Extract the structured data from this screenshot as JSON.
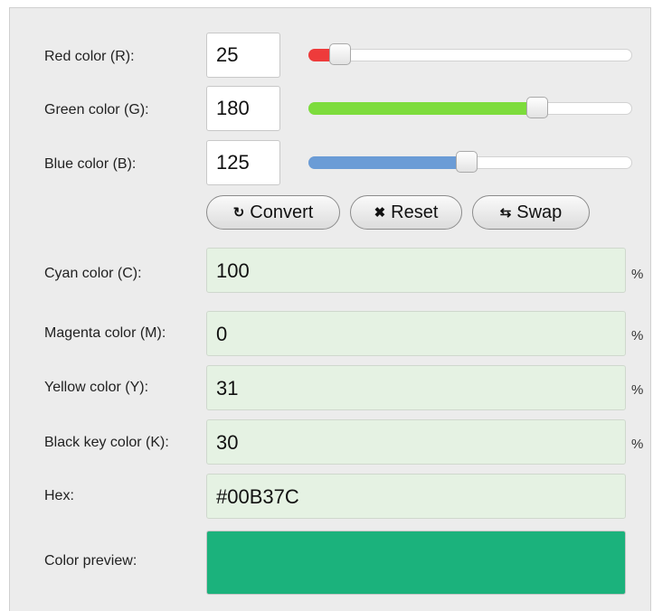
{
  "rgb": {
    "red": {
      "label": "Red color (R):",
      "value": "25",
      "level": 0.098,
      "color": "#ee3b3b"
    },
    "green": {
      "label": "Green color (G):",
      "value": "180",
      "level": 0.706,
      "color": "#7ddc3c"
    },
    "blue": {
      "label": "Blue color (B):",
      "value": "125",
      "level": 0.49,
      "color": "#6b9cd6"
    }
  },
  "buttons": {
    "convert": {
      "icon": "↻",
      "label": "Convert"
    },
    "reset": {
      "icon": "✖",
      "label": "Reset"
    },
    "swap": {
      "icon": "⇆",
      "label": "Swap"
    }
  },
  "cmyk": {
    "cyan": {
      "label": "Cyan color (C):",
      "value": "100",
      "unit": "%"
    },
    "magenta": {
      "label": "Magenta color (M):",
      "value": "0",
      "unit": "%"
    },
    "yellow": {
      "label": "Yellow color (Y):",
      "value": "31",
      "unit": "%"
    },
    "black": {
      "label": "Black key color (K):",
      "value": "30",
      "unit": "%"
    }
  },
  "hex": {
    "label": "Hex:",
    "value": "#00B37C"
  },
  "preview": {
    "label": "Color preview:",
    "color": "#1bb27c"
  }
}
